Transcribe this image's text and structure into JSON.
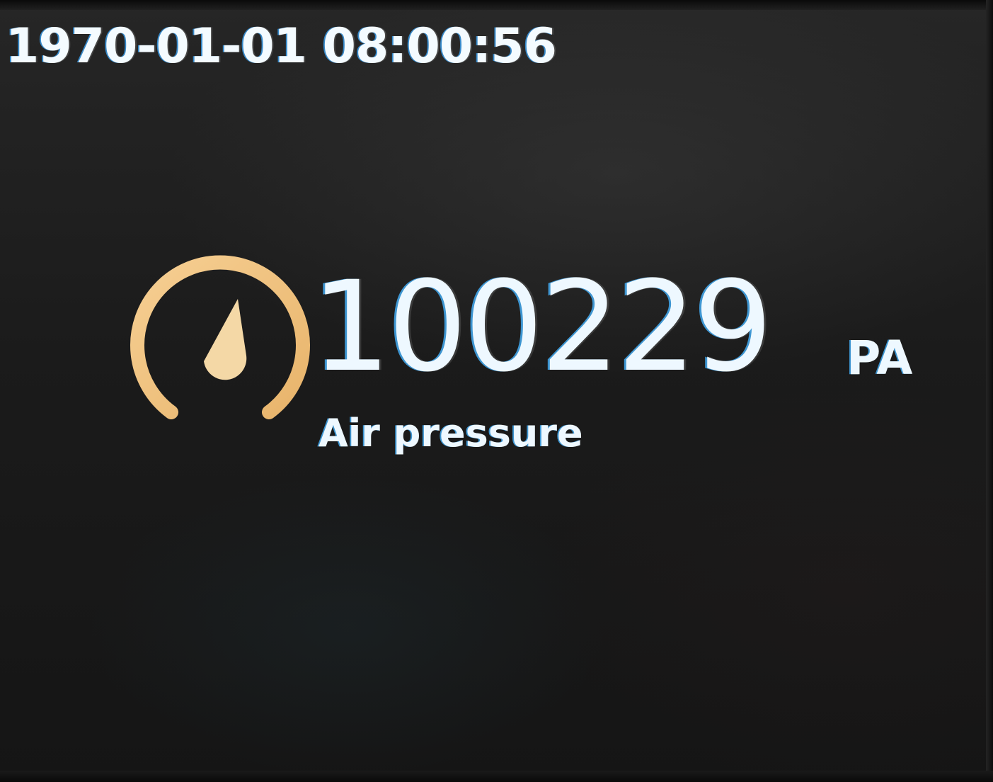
{
  "header": {
    "datetime": "1970-01-01 08:00:56"
  },
  "sensor": {
    "icon": "gauge-icon",
    "value": "100229",
    "unit": "PA",
    "label": "Air pressure"
  },
  "colors": {
    "background": "#1a1a1a",
    "text": "#eef8ff",
    "icon_accent": "#f3c98a"
  }
}
